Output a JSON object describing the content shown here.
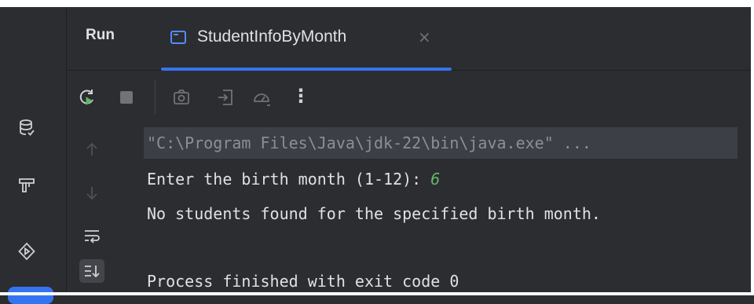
{
  "tabs": {
    "run_label": "Run",
    "active_tab": {
      "title": "StudentInfoByMonth",
      "close": "×",
      "icon": "console-icon"
    }
  },
  "toolbar": {
    "buttons": [
      "rerun-icon",
      "stop-icon",
      "camera-icon",
      "import-icon",
      "gauge-icon",
      "more-icon"
    ],
    "more_label": "⋮"
  },
  "sidebar": {
    "icons": [
      "database-icon",
      "build-hammer-icon",
      "services-run-icon"
    ]
  },
  "console": {
    "command": "\"C:\\Program Files\\Java\\jdk-22\\bin\\java.exe\" ...",
    "prompt": "Enter the birth month (1-12): ",
    "input": "6",
    "message": "No students found for the specified birth month.",
    "exit": "Process finished with exit code 0"
  },
  "colors": {
    "background": "#2b2d30",
    "accent": "#3574f0",
    "input_green": "#5fb865",
    "text": "#dfe1e5",
    "muted": "#8c8f94"
  }
}
